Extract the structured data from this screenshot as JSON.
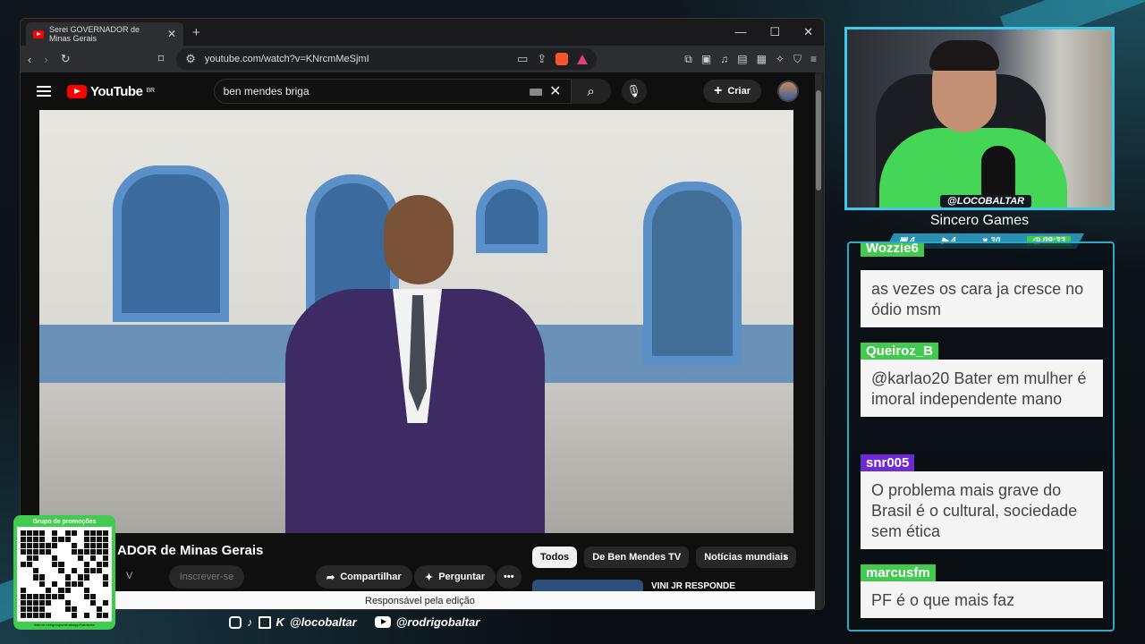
{
  "browser": {
    "tab_title": "Serei GOVERNADOR de Minas Gerais",
    "url": "youtube.com/watch?v=KNrcmMeSjmI"
  },
  "youtube": {
    "logo_text": "YouTube",
    "country_code": "BR",
    "search_query": "ben mendes briga",
    "create_label": "Criar",
    "video_title": "ADOR de Minas Gerais",
    "channel_suffix": "V",
    "subscribe_label": "Inscrever-se",
    "share_label": "Compartilhar",
    "ask_label": "Perguntar",
    "more_label": "•••",
    "chips": [
      "Todos",
      "De Ben Mendes TV",
      "Notícias mundiais"
    ],
    "related_title": "VINI JR RESPONDE",
    "tooltip": "Responsável pela edição"
  },
  "overlay": {
    "qr_title": "Grupo de promoções",
    "qr_url": "rbstore.net/groups/whatsapp/hardware",
    "social_handle_1": "@locobaltar",
    "social_handle_2": "@rodrigobaltar"
  },
  "stream": {
    "handle": "@LOCOBALTAR",
    "title": "Sincero Games",
    "stats": [
      "4",
      "4",
      "30",
      "09:33"
    ]
  },
  "chat": [
    {
      "user": "Wozzie6",
      "text": "as vezes os cara ja cresce no ódio msm",
      "color": "#43c94f"
    },
    {
      "user": "Queiroz_B",
      "text": "@karlao20 Bater em mulher é imoral independente mano",
      "color": "#43c94f"
    },
    {
      "user": "snr005",
      "text": "O problema mais grave do Brasil é o cultural, sociedade sem ética",
      "color": "#6f2bd0"
    },
    {
      "user": "marcusfm",
      "text": "PF é o que mais faz",
      "color": "#43c94f"
    }
  ]
}
